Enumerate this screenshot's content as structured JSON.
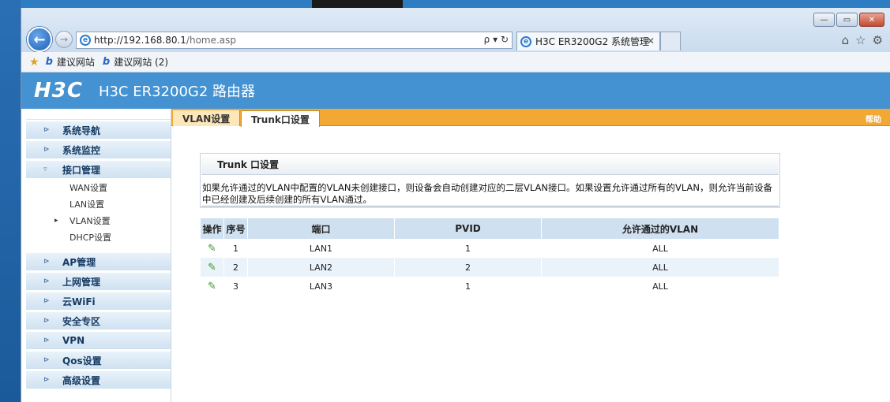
{
  "browser": {
    "url_host": "http://192.168.80.1",
    "url_path": "/home.asp",
    "search_tools": "ρ ▾ ↻",
    "tab_title": "H3C ER3200G2 系统管理",
    "tab_close": "✕",
    "favorites": [
      "建议网站",
      "建议网站 (2)"
    ]
  },
  "header": {
    "logo": "H3C",
    "product": "H3C ER3200G2 路由器"
  },
  "sidebar": {
    "menu": [
      {
        "label": "系统导航"
      },
      {
        "label": "系统监控"
      },
      {
        "label": "接口管理",
        "expanded": true,
        "children": [
          "WAN设置",
          "LAN设置",
          "VLAN设置",
          "DHCP设置"
        ],
        "selected_child": "VLAN设置"
      },
      {
        "label": "AP管理"
      },
      {
        "label": "上网管理"
      },
      {
        "label": "云WiFi"
      },
      {
        "label": "安全专区"
      },
      {
        "label": "VPN"
      },
      {
        "label": "Qos设置"
      },
      {
        "label": "高级设置"
      }
    ]
  },
  "page_tabs": [
    {
      "label": "VLAN设置",
      "active": false
    },
    {
      "label": "Trunk口设置",
      "active": true
    }
  ],
  "help": "帮助",
  "trunk": {
    "title": "Trunk 口设置",
    "description": "如果允许通过的VLAN中配置的VLAN未创建接口，则设备会自动创建对应的二层VLAN接口。如果设置允许通过所有的VLAN，则允许当前设备中已经创建及后续创建的所有VLAN通过。"
  },
  "table": {
    "headers": {
      "op": "操作",
      "no": "序号",
      "port": "端口",
      "pvid": "PVID",
      "vlan": "允许通过的VLAN"
    },
    "rows": [
      {
        "no": "1",
        "port": "LAN1",
        "pvid": "1",
        "vlan": "ALL"
      },
      {
        "no": "2",
        "port": "LAN2",
        "pvid": "2",
        "vlan": "ALL"
      },
      {
        "no": "3",
        "port": "LAN3",
        "pvid": "1",
        "vlan": "ALL"
      }
    ]
  },
  "icons": {
    "back": "arrow-left-icon",
    "forward": "arrow-right-icon",
    "edit": "pencil-icon",
    "favorites_star": "star-icon"
  },
  "colors": {
    "banner": "#4592d2",
    "tabbar": "#f2a833",
    "table_header": "#cfe0f1"
  }
}
